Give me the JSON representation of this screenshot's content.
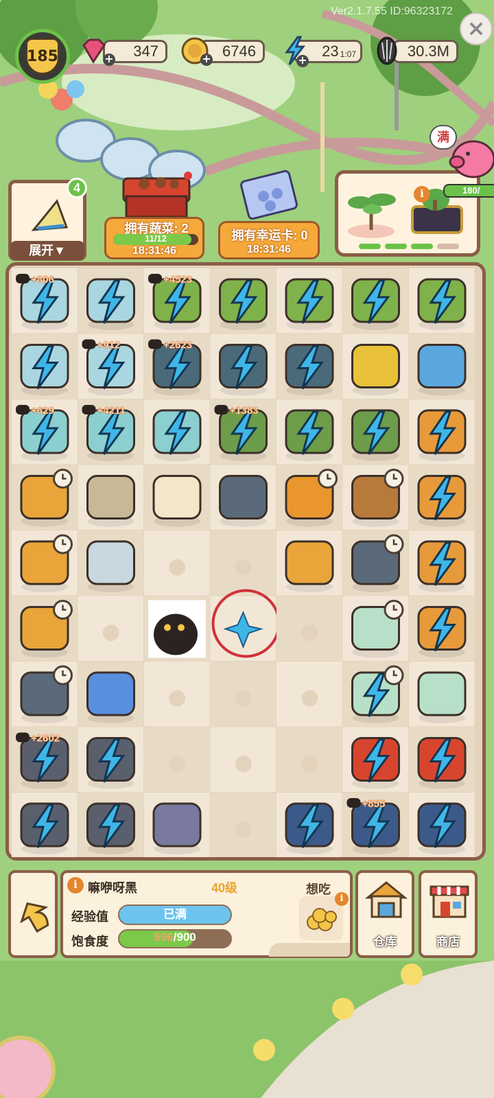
{
  "header": {
    "version": "Ver2.1.7.55 ID:96323172",
    "level": "185",
    "gems": "347",
    "coins": "6746",
    "energy": "23",
    "energy_timer": "1:07",
    "seeds": "30.3M"
  },
  "orders": {
    "expand_count": "4",
    "expand_label": "展开▼",
    "order1_title": "拥有蔬菜: 2",
    "order1_progress": "11/12",
    "order1_timer": "18:31:46",
    "order2_title": "拥有幸运卡: 0",
    "order2_timer": "18:31:46",
    "piggy_full": "满",
    "piggy_progress": "180/"
  },
  "board": {
    "badges": [
      "+806",
      "+4523",
      "+912",
      "+2623",
      "+629",
      "+4211",
      "+1383",
      "+2602",
      "+855"
    ]
  },
  "pet": {
    "name": "嘛咿呀黑",
    "level": "40级",
    "exp_label": "经验值",
    "exp_value": "已满",
    "fullness_label": "饱食度",
    "fullness_current": "596",
    "fullness_max": "/900",
    "fullness_ratio": 0.662,
    "wants_label": "想吃"
  },
  "buttons": {
    "warehouse": "仓库",
    "shop": "商店"
  },
  "colors": {
    "board_border": "#8a5e47",
    "energy_blue": "#3fb6e8",
    "badge_orange": "#f08a3c",
    "green_bar": "#7cc94a",
    "circle_red": "#d0323a"
  }
}
